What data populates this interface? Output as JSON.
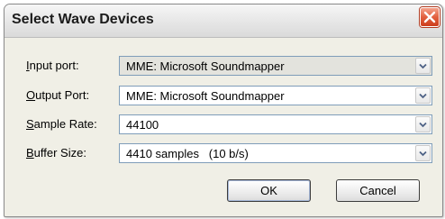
{
  "dialog": {
    "title": "Select Wave Devices",
    "close_icon": "close-x-icon"
  },
  "fields": [
    {
      "label_mnemonic": "I",
      "label_rest": "nput port:",
      "value": "MME: Microsoft Soundmapper",
      "enabled": false
    },
    {
      "label_mnemonic": "O",
      "label_rest": "utput Port:",
      "value": "MME: Microsoft Soundmapper",
      "enabled": true
    },
    {
      "label_mnemonic": "S",
      "label_rest": "ample Rate:",
      "value": "44100",
      "enabled": true
    },
    {
      "label_mnemonic": "B",
      "label_rest": "uffer Size:",
      "value": "4410 samples   (10 b/s)",
      "enabled": true
    }
  ],
  "buttons": {
    "ok": "OK",
    "cancel": "Cancel"
  },
  "colors": {
    "dialog_bg": "#f0efe6",
    "close_button": "#e2603f",
    "field_border": "#7f9db9"
  }
}
